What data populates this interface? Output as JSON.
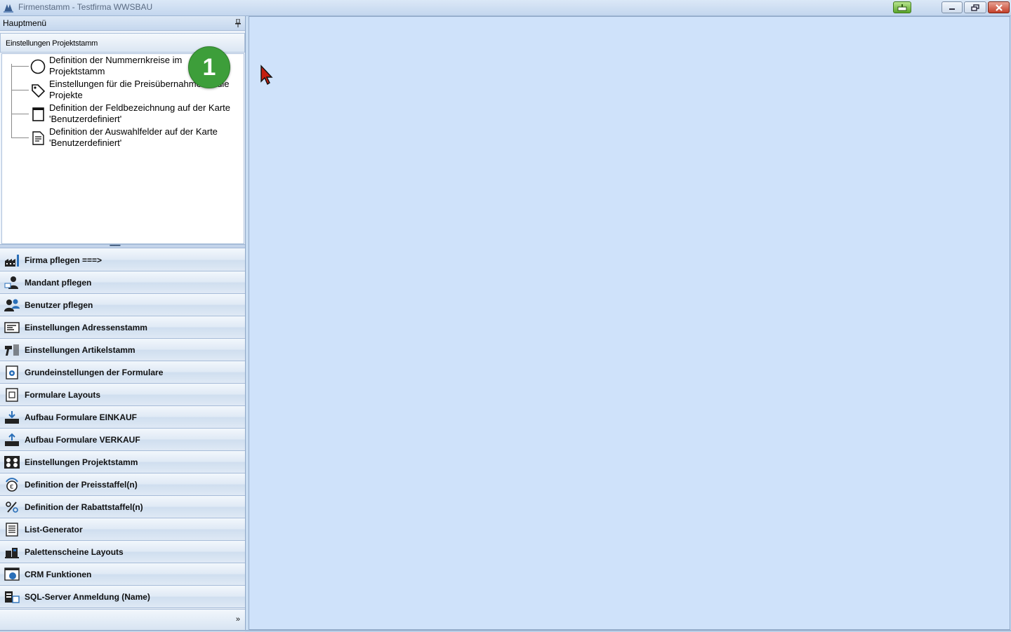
{
  "window": {
    "title": "Firmenstamm - Testfirma WWSBAU",
    "controls": [
      "minimize-icon",
      "restore-icon",
      "close-icon"
    ]
  },
  "sidebar": {
    "header": "Hauptmenü",
    "group": {
      "title": "Einstellungen Projektstamm",
      "items": [
        {
          "label": "Definition der Nummernkreise im Projektstamm",
          "icon": "circle-icon"
        },
        {
          "label": "Einstellungen für die Preisübernahme für die Projekte",
          "icon": "tag-icon"
        },
        {
          "label": "Definition der Feldbezeichnung auf der Karte 'Benutzerdefiniert'",
          "icon": "form-icon"
        },
        {
          "label": "Definition der Auswahlfelder auf der Karte 'Benutzerdefiniert'",
          "icon": "document-icon"
        }
      ]
    },
    "badge": "1",
    "nav": [
      {
        "label": "Firma pflegen   ===>",
        "icon": "factory-icon"
      },
      {
        "label": "Mandant pflegen",
        "icon": "client-icon"
      },
      {
        "label": "Benutzer pflegen",
        "icon": "users-icon"
      },
      {
        "label": "Einstellungen Adressenstamm",
        "icon": "address-card-icon"
      },
      {
        "label": "Einstellungen Artikelstamm",
        "icon": "barcode-scanner-icon"
      },
      {
        "label": "Grundeinstellungen der Formulare",
        "icon": "gear-document-icon"
      },
      {
        "label": "Formulare Layouts",
        "icon": "layout-icon"
      },
      {
        "label": "Aufbau Formulare EINKAUF",
        "icon": "inbox-download-icon"
      },
      {
        "label": "Aufbau Formulare VERKAUF",
        "icon": "inbox-upload-icon"
      },
      {
        "label": "Einstellungen Projektstamm",
        "icon": "project-icon"
      },
      {
        "label": "Definition der Preisstaffel(n)",
        "icon": "price-scale-icon"
      },
      {
        "label": "Definition der Rabattstaffel(n)",
        "icon": "discount-icon"
      },
      {
        "label": "List-Generator",
        "icon": "list-icon"
      },
      {
        "label": "Palettenscheine Layouts",
        "icon": "pallet-icon"
      },
      {
        "label": "CRM Funktionen",
        "icon": "crm-icon"
      },
      {
        "label": "SQL-Server Anmeldung (Name)",
        "icon": "server-icon"
      }
    ],
    "footer_chevron": "»"
  }
}
